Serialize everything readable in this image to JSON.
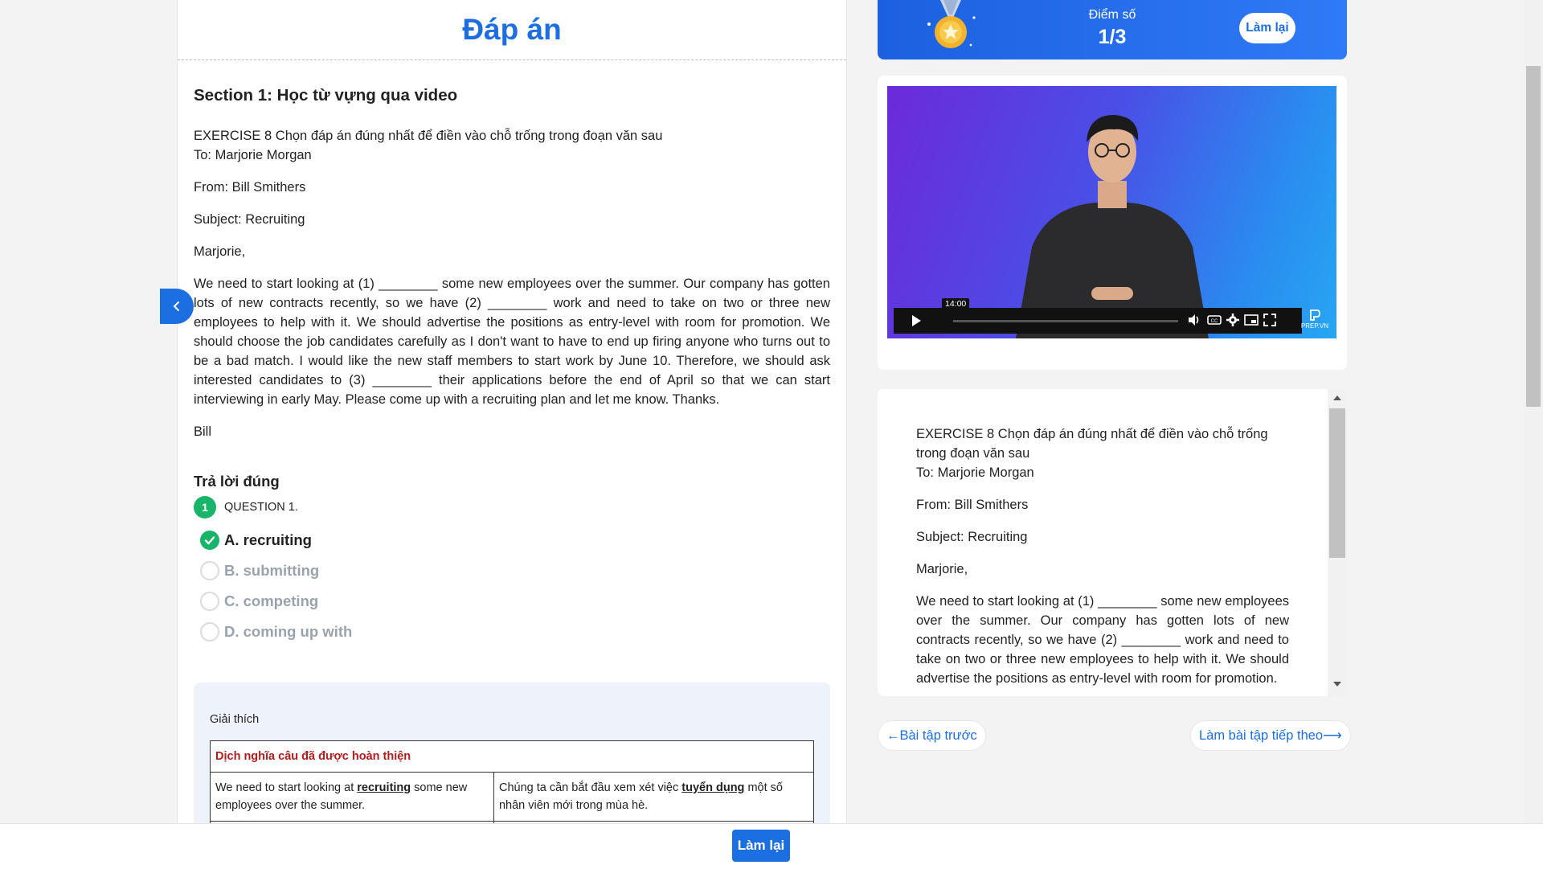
{
  "left": {
    "title": "Đáp án",
    "section_title": "Section 1: Học từ vựng qua video",
    "exercise_line": "EXERCISE 8 Chọn đáp án đúng nhất để điền vào chỗ trống trong đoạn văn sau",
    "to": "To: Marjorie Morgan",
    "from": "From: Bill Smithers",
    "subject": "Subject: Recruiting",
    "greeting": "Marjorie,",
    "body": "We need to start looking at (1) ________ some new employees over the summer. Our company has gotten lots of new contracts recently, so we have (2) ________ work and need to take on two or three new employees to help with it. We should advertise the positions as entry-level with room for promotion. We should choose the job candidates carefully as I don't want to have to end up firing anyone who turns out to be a bad match. I would like the new staff members to start work by June 10. Therefore, we should ask interested candidates to (3) ________ their applications before the end of April so that we can start interviewing in early May. Please come up with a recruiting plan and let me know. Thanks.",
    "signature": "Bill",
    "answer_title": "Trả lời đúng",
    "question_number": "1",
    "question_label": "QUESTION 1.",
    "options": [
      {
        "label": "A. recruiting",
        "state": "correct"
      },
      {
        "label": "B. submitting",
        "state": "none"
      },
      {
        "label": "C. competing",
        "state": "none"
      },
      {
        "label": "D. coming up with",
        "state": "none"
      }
    ],
    "explain_label": "Giải thích",
    "table_header": "Dịch nghĩa câu đã được hoàn thiện",
    "row_en_before": "We need to start looking at ",
    "row_en_kw": "recruiting",
    "row_en_after": " some new employees over the summer.",
    "row_vi_before": "Chúng ta cần bắt đầu xem xét việc ",
    "row_vi_kw": "tuyển dụng",
    "row_vi_after": " một số nhân viên mới trong mùa hè."
  },
  "score": {
    "label": "Điểm số",
    "value": "1/3",
    "redo_label": "Làm lại"
  },
  "video": {
    "timestamp": "14:00",
    "brand": "PREP.VN"
  },
  "text_panel": {
    "exercise_line": "EXERCISE 8 Chọn đáp án đúng nhất để điền vào chỗ trống trong đoạn văn sau",
    "to": "To: Marjorie Morgan",
    "from": "From: Bill Smithers",
    "subject": "Subject: Recruiting",
    "greeting": "Marjorie,",
    "body": "We need to start looking at (1) ________ some new employees over the summer. Our company has gotten lots of new contracts recently, so we have (2) ________ work and need to take on two or three new employees to help with it. We should advertise the positions as entry-level with room for promotion."
  },
  "nav": {
    "prev_label": "←Bài tập trước",
    "next_label": "Làm bài tập tiếp theo⟶"
  },
  "bottom": {
    "redo_label": "Làm lại"
  },
  "colors": {
    "accent": "#1c6fe0",
    "success": "#18b46a",
    "explain_header": "#b41c1c"
  }
}
